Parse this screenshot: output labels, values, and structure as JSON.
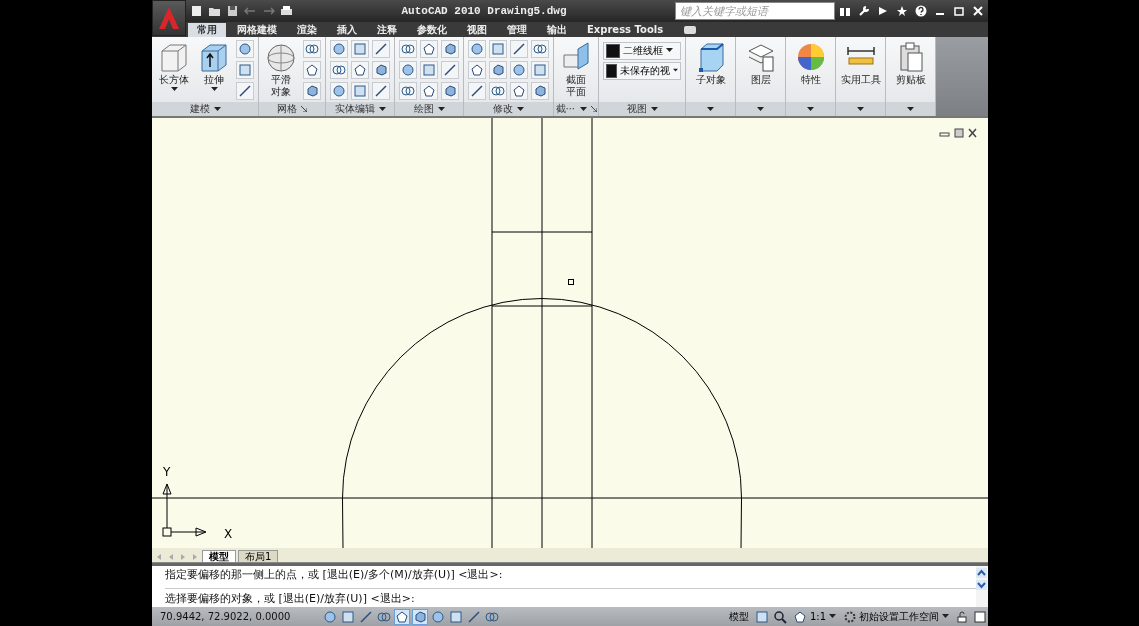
{
  "window": {
    "title": "AutoCAD 2010  Drawing5.dwg",
    "search": {
      "placeholder": "键入关键字或短语"
    }
  },
  "tabs": [
    {
      "label": "常用",
      "selected": true
    },
    {
      "label": "网格建模",
      "selected": false
    },
    {
      "label": "渲染",
      "selected": false
    },
    {
      "label": "插入",
      "selected": false
    },
    {
      "label": "注释",
      "selected": false
    },
    {
      "label": "参数化",
      "selected": false
    },
    {
      "label": "视图",
      "selected": false
    },
    {
      "label": "管理",
      "selected": false
    },
    {
      "label": "输出",
      "selected": false
    },
    {
      "label": "Express Tools",
      "selected": false
    }
  ],
  "panels": [
    {
      "title": "建模",
      "dropdown": true,
      "launcher": false,
      "buttons": [
        {
          "label": "长方体",
          "dropdown": true
        },
        {
          "label": "拉伸",
          "dropdown": true
        }
      ]
    },
    {
      "title": "网格",
      "dropdown": false,
      "launcher": true,
      "buttons": [
        {
          "label": "平滑对象",
          "dropdown": false
        }
      ]
    },
    {
      "title": "实体编辑",
      "dropdown": true,
      "launcher": false
    },
    {
      "title": "绘图",
      "dropdown": true,
      "launcher": false
    },
    {
      "title": "修改",
      "dropdown": true,
      "launcher": false
    },
    {
      "title": "截⋯",
      "dropdown": true,
      "launcher": true,
      "buttons": [
        {
          "label": "截面平面",
          "dropdown": false
        }
      ]
    },
    {
      "title": "视图",
      "dropdown": true,
      "launcher": false,
      "combos": [
        "二维线框",
        "未保存的视"
      ]
    },
    {
      "dropdown": true,
      "launcher": false,
      "buttons": [
        {
          "label": "子对象",
          "dropdown": false
        }
      ]
    },
    {
      "dropdown": true,
      "launcher": false,
      "buttons": [
        {
          "label": "图层",
          "dropdown": false
        }
      ]
    },
    {
      "dropdown": true,
      "launcher": false,
      "buttons": [
        {
          "label": "特性",
          "dropdown": false
        }
      ]
    },
    {
      "dropdown": true,
      "launcher": false,
      "buttons": [
        {
          "label": "实用工具",
          "dropdown": false
        }
      ]
    },
    {
      "dropdown": true,
      "launcher": false,
      "buttons": [
        {
          "label": "剪贴板",
          "dropdown": false
        }
      ]
    }
  ],
  "canvas": {
    "ucs": {
      "x": "X",
      "y": "Y"
    }
  },
  "layout_tabs": [
    {
      "label": "模型",
      "selected": true
    },
    {
      "label": "布局1",
      "selected": false
    }
  ],
  "command_lines": [
    "指定要偏移的那一侧上的点，或 [退出(E)/多个(M)/放弃(U)] <退出>:",
    "选择要偏移的对象，或 [退出(E)/放弃(U)] <退出>:"
  ],
  "status_bar": {
    "coordinates": "70.9442, 72.9022, 0.0000",
    "toggles": [
      {
        "on": false
      },
      {
        "on": false
      },
      {
        "on": false
      },
      {
        "on": false
      },
      {
        "on": true
      },
      {
        "on": true
      },
      {
        "on": false
      },
      {
        "on": false
      },
      {
        "on": false
      },
      {
        "on": false
      }
    ],
    "model": "模型",
    "scale": "1:1",
    "workspace": "初始设置工作空间"
  }
}
